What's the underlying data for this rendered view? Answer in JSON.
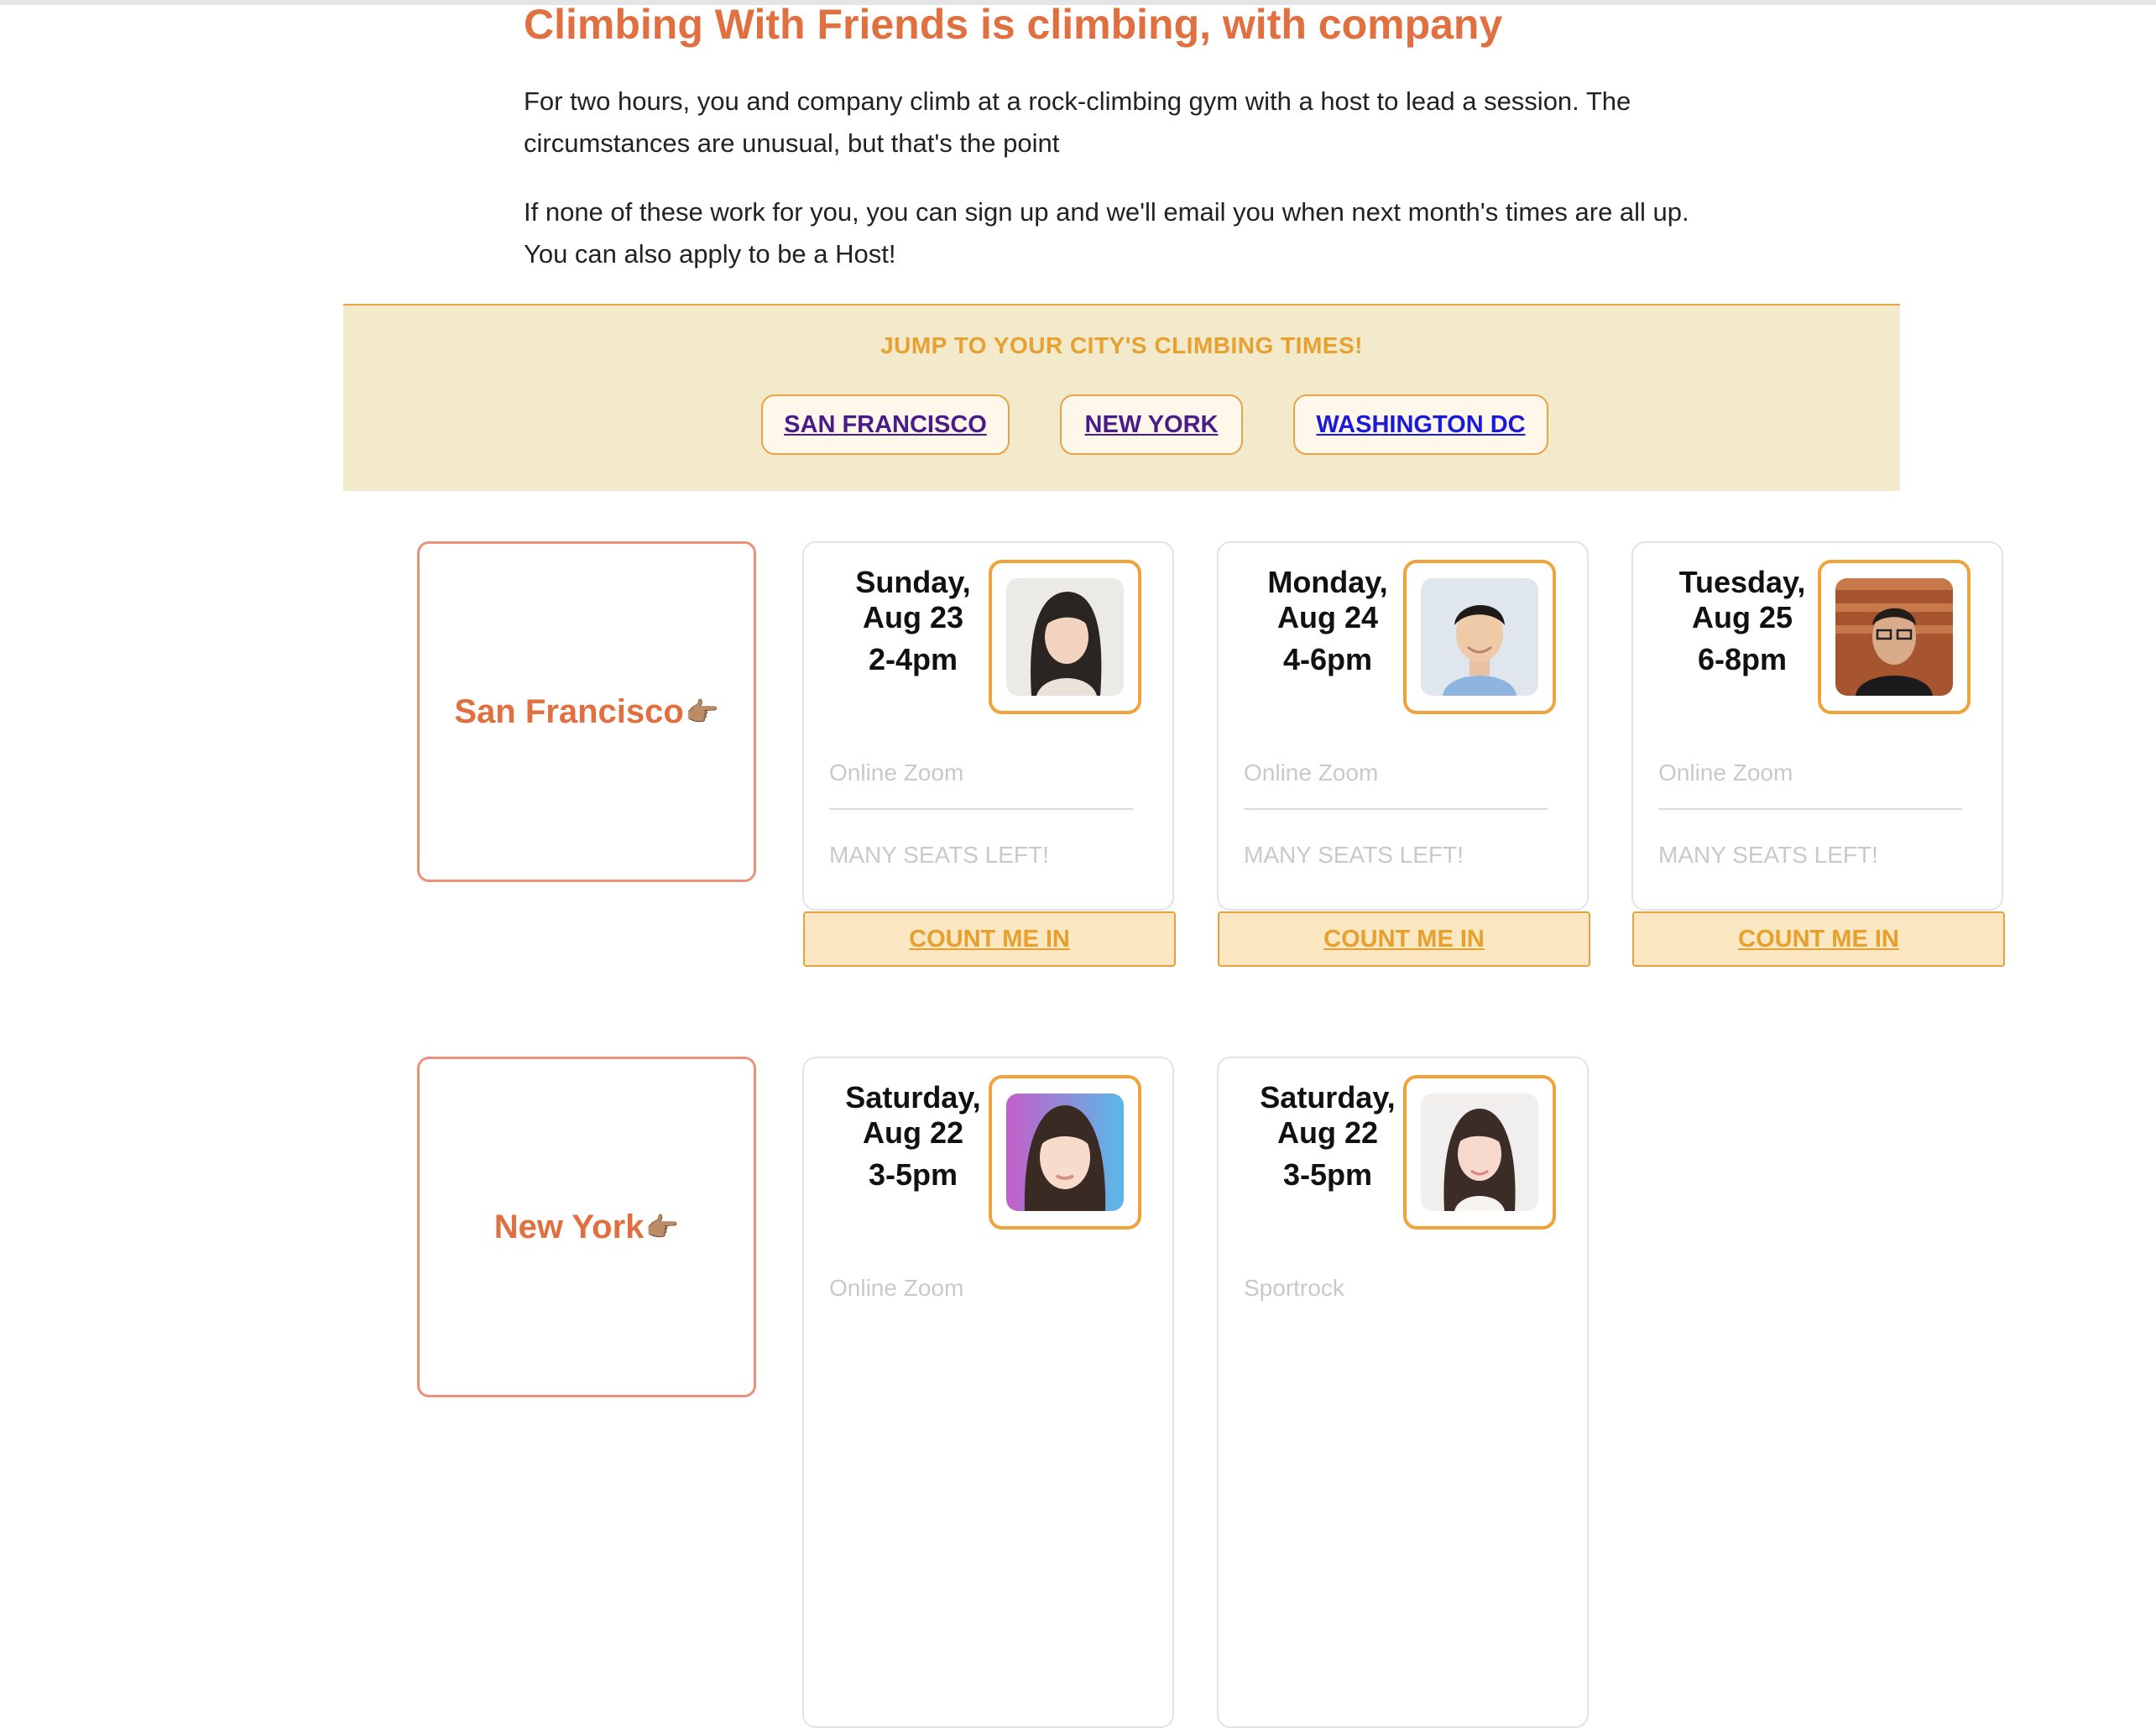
{
  "intro": {
    "headline": "Climbing With Friends is climbing, with company",
    "paragraph_1": "For two hours, you and company climb at a rock-climbing gym with a host to lead a session. The circumstances are unusual, but that's the point",
    "paragraph_2": "If none of these work for you, you can sign up and we'll email you when next month's times are all up. You can also apply to be a Host!"
  },
  "jump": {
    "title": "JUMP TO YOUR CITY'S CLIMBING TIMES!",
    "links": [
      {
        "label": "SAN FRANCISCO",
        "state": "visited"
      },
      {
        "label": "NEW YORK",
        "state": "visited"
      },
      {
        "label": "WASHINGTON DC",
        "state": "unvisited"
      }
    ]
  },
  "cities": [
    {
      "name": "San Francisco",
      "pointer": "👉🏽",
      "sessions": [
        {
          "day": "Sunday,",
          "date": "Aug 23",
          "time": "2-4pm",
          "location": "Online Zoom",
          "seats": "MANY SEATS LEFT!",
          "cta": "COUNT ME IN"
        },
        {
          "day": "Monday,",
          "date": "Aug 24",
          "time": "4-6pm",
          "location": "Online Zoom",
          "seats": "MANY SEATS LEFT!",
          "cta": "COUNT ME IN"
        },
        {
          "day": "Tuesday,",
          "date": "Aug 25",
          "time": "6-8pm",
          "location": "Online Zoom",
          "seats": "MANY SEATS LEFT!",
          "cta": "COUNT ME IN"
        }
      ]
    },
    {
      "name": "New York",
      "pointer": "👉🏽",
      "sessions": [
        {
          "day": "Saturday,",
          "date": "Aug 22",
          "time": "3-5pm",
          "location": "Online Zoom"
        },
        {
          "day": "Saturday,",
          "date": "Aug 22",
          "time": "3-5pm",
          "location": "Sportrock"
        }
      ]
    }
  ],
  "colors": {
    "accent_orange": "#e07040",
    "gold": "#e7a131",
    "panel_bg": "#f3e9cb",
    "visited_link": "#4b1b8a",
    "unvisited_link": "#1a1ade"
  }
}
